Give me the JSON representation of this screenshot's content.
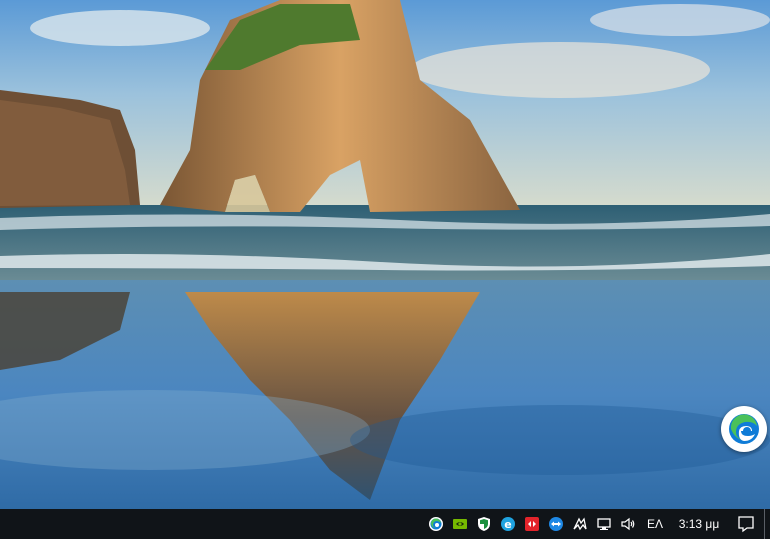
{
  "desktop": {
    "edge_icon": "edge-icon"
  },
  "taskbar": {
    "tray_icons": [
      {
        "name": "edge-tray-icon",
        "label": ""
      },
      {
        "name": "nvidia-icon",
        "label": ""
      },
      {
        "name": "windows-security-icon",
        "label": ""
      },
      {
        "name": "internet-explorer-icon",
        "label": ""
      },
      {
        "name": "red-app-icon",
        "label": ""
      },
      {
        "name": "teamviewer-icon",
        "label": ""
      },
      {
        "name": "bluetooth-tray-icon",
        "label": ""
      },
      {
        "name": "network-icon",
        "label": ""
      },
      {
        "name": "volume-icon",
        "label": ""
      }
    ],
    "language": "ΕΛ",
    "clock": "3:13 μμ",
    "notification_icon": "action-center-icon"
  },
  "colors": {
    "taskbar_bg": "#101418",
    "edge_blue": "#0f7cd7",
    "edge_green": "#4ac15a",
    "nvidia_green": "#76b900",
    "red_app": "#e3242b"
  }
}
